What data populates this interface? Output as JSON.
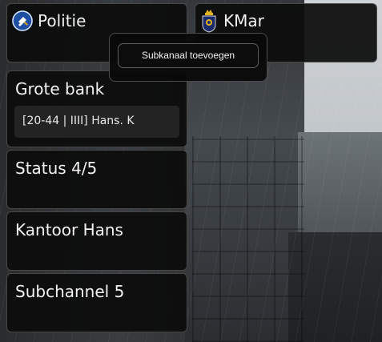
{
  "channels": [
    {
      "id": "politie",
      "name": "Politie",
      "icon": "police-badge-icon"
    },
    {
      "id": "kmar",
      "name": "KMar",
      "icon": "kmar-emblem-icon"
    }
  ],
  "subchannels": [
    {
      "name": "Grote bank",
      "members": [
        "[20-44 | IIII] Hans. K"
      ]
    },
    {
      "name": "Status 4/5",
      "members": []
    },
    {
      "name": "Kantoor Hans",
      "members": []
    },
    {
      "name": "Subchannel 5",
      "members": []
    }
  ],
  "popup": {
    "add_subchannel_label": "Subkanaal toevoegen"
  },
  "colors": {
    "police_blue": "#1f4fa3",
    "kmar_navy": "#1a2a6b",
    "card_bg": "#0c0c0c"
  }
}
